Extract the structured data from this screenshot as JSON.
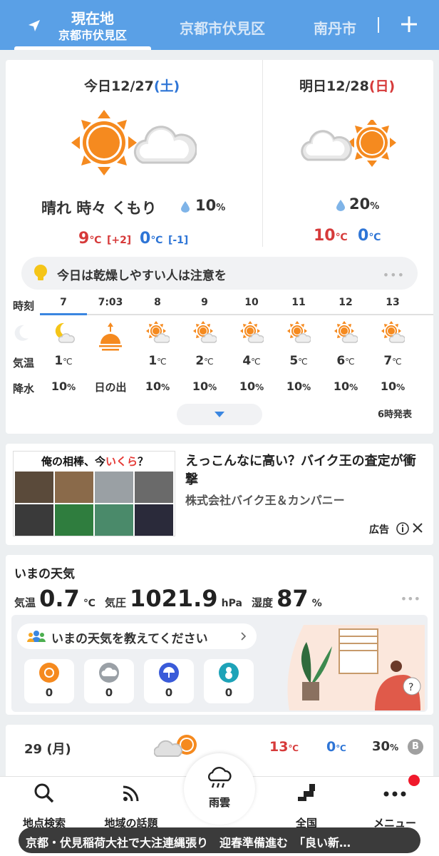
{
  "header": {
    "active_tab": {
      "title": "現在地",
      "subtitle": "京都市伏見区"
    },
    "tab2": "京都市伏見区",
    "tab3": "南丹市",
    "icons": {
      "location": "location-arrow-icon",
      "add": "plus-icon"
    }
  },
  "forecast": {
    "today": {
      "label": "今日12/27",
      "dow": "(土)",
      "condition": "晴れ 時々 くもり",
      "precip": "10",
      "precip_unit": "%",
      "high": "9",
      "high_diff": "[+2]",
      "low": "0",
      "low_diff": "[-1]",
      "unit": "℃"
    },
    "tomorrow": {
      "label": "明日12/28",
      "dow": "(日)",
      "precip": "20",
      "precip_unit": "%",
      "high": "10",
      "low": "0",
      "unit": "℃"
    },
    "tip": "今日は乾燥しやすい人は注意を",
    "tip_more": "•••",
    "row_labels": {
      "time": "時刻",
      "temp": "気温",
      "rain": "降水"
    },
    "hours": [
      {
        "time": "7",
        "icon": "moon-cloud-icon",
        "temp": "1",
        "rain": "10"
      },
      {
        "time": "7:03",
        "icon": "sunrise-icon",
        "temp": "日の出",
        "rain": ""
      },
      {
        "time": "8",
        "icon": "sun-cloud-icon",
        "temp": "1",
        "rain": "10"
      },
      {
        "time": "9",
        "icon": "sun-cloud-icon",
        "temp": "2",
        "rain": "10"
      },
      {
        "time": "10",
        "icon": "sun-cloud-icon",
        "temp": "4",
        "rain": "10"
      },
      {
        "time": "11",
        "icon": "sun-cloud-icon",
        "temp": "5",
        "rain": "10"
      },
      {
        "time": "12",
        "icon": "sun-cloud-icon",
        "temp": "6",
        "rain": "10"
      },
      {
        "time": "13",
        "icon": "sun-cloud-icon",
        "temp": "7",
        "rain": "10"
      }
    ],
    "issued": "6時発表"
  },
  "ad": {
    "banner_a": "俺の相棒、今",
    "banner_b": "いくら",
    "banner_c": "？",
    "title": "えっこんなに高い？バイク王の査定が衝撃",
    "company": "株式会社バイク王＆カンパニー",
    "label": "広告"
  },
  "current": {
    "title": "いまの天気",
    "temp_label": "気温",
    "temp": "0.7",
    "temp_unit": "℃",
    "pressure_label": "気圧",
    "pressure": "1021.9",
    "pressure_unit": "hPa",
    "humidity_label": "湿度",
    "humidity": "87",
    "humidity_unit": "%",
    "ask": "いまの天気を教えてください",
    "reports": [
      {
        "icon": "sun-report-icon",
        "count": "0"
      },
      {
        "icon": "cloud-report-icon",
        "count": "0"
      },
      {
        "icon": "umbrella-report-icon",
        "count": "0"
      },
      {
        "icon": "snowman-report-icon",
        "count": "0"
      }
    ]
  },
  "weekly": {
    "day": "29 (月)",
    "high": "13",
    "low": "0",
    "pop": "30",
    "unit": "℃",
    "pct": "%",
    "badge": "B"
  },
  "nav": {
    "search": "地点検索",
    "topics": "地域の話題",
    "rain": "雨雲",
    "national": "全国",
    "menu": "メニュー"
  },
  "ticker": "京都・伏見稲荷大社で大注連縄張り　迎春準備進む　「良い新…",
  "colors": {
    "header": "#5aa0e6",
    "sun": "#f58a1f",
    "red": "#d63a3a",
    "blue": "#2e75d6"
  }
}
